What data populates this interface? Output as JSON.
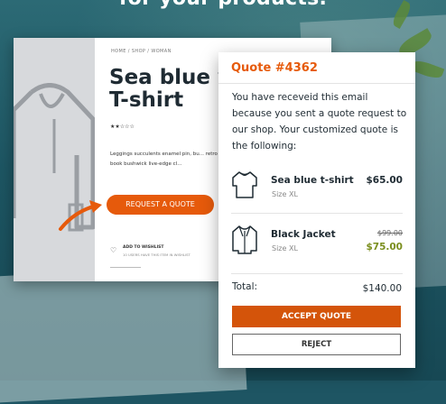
{
  "hero": {
    "headline": "for your products."
  },
  "product": {
    "breadcrumb": "HOME / SHOP / WOMAN",
    "title_line1": "Sea blue v",
    "title_line2": "T-shirt",
    "rating_stars": 2,
    "rating_display": "★★☆☆☆",
    "description": "Leggings succulents enamel pin, bu... retro meh listicle literally banjo. Butc... coloring book bushwick live-edge cl...",
    "quote_button_label": "REQUEST A QUOTE",
    "wishlist_label": "ADD TO WISHLIST",
    "wishlist_sub": "10 USERS HAVE THIS ITEM IN WISHLIST"
  },
  "quote": {
    "title": "Quote #4362",
    "message": "You have receveid this email because you sent a quote request to our shop. Your customized quote is the following:",
    "items": [
      {
        "name": "Sea blue t-shirt",
        "size": "Size XL",
        "price": "$65.00",
        "icon": "tshirt-icon"
      },
      {
        "name": "Black Jacket",
        "size": "Size XL",
        "old_price": "$99.00",
        "new_price": "$75.00",
        "icon": "jacket-icon"
      }
    ],
    "total_label": "Total:",
    "total_value": "$140.00",
    "accept_label": "ACCEPT QUOTE",
    "reject_label": "REJECT"
  },
  "colors": {
    "accent": "#e65a0b",
    "discount": "#7a8e1d",
    "background": "#1e5563"
  }
}
